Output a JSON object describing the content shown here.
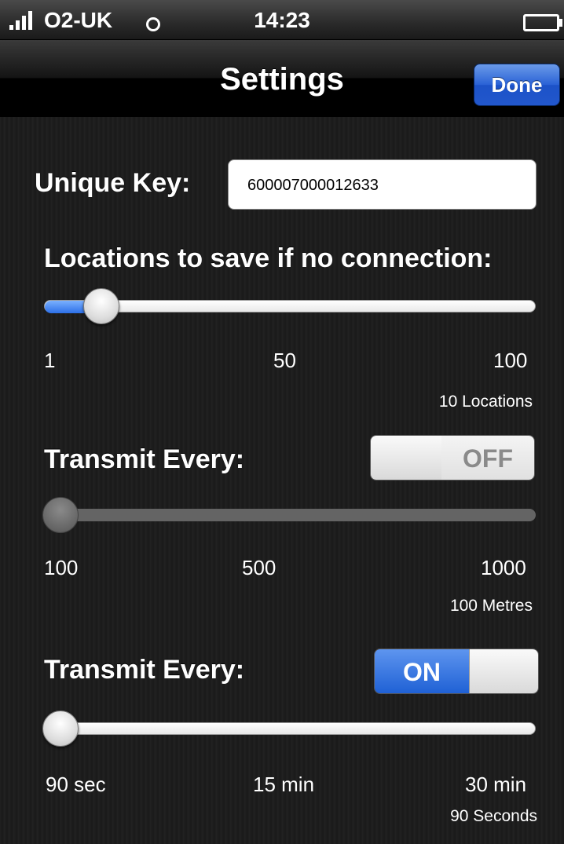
{
  "status_bar": {
    "carrier": "O2-UK",
    "time": "14:23"
  },
  "nav": {
    "title": "Settings",
    "done_label": "Done"
  },
  "unique_key": {
    "label": "Unique Key:",
    "value": "600007000012633"
  },
  "locations": {
    "label": "Locations to save if no connection:",
    "ticks": [
      "1",
      "50",
      "100"
    ],
    "value_text": "10 Locations",
    "slider_value": 10,
    "slider_min": 1,
    "slider_max": 100
  },
  "distance": {
    "label": "Transmit Every:",
    "switch_label": "OFF",
    "switch_on": false,
    "ticks": [
      "100",
      "500",
      "1000"
    ],
    "value_text": "100 Metres",
    "slider_value": 100,
    "slider_min": 100,
    "slider_max": 1000
  },
  "time_interval": {
    "label": "Transmit Every:",
    "switch_label": "ON",
    "switch_on": true,
    "ticks": [
      "90 sec",
      "15 min",
      "30 min"
    ],
    "value_text": "90 Seconds",
    "slider_value": 90,
    "slider_min": 90,
    "slider_max": 1800
  },
  "colors": {
    "accent_blue": "#2d70e8",
    "background": "#1d1d1d"
  },
  "icons": [
    "signal-bars-icon",
    "wifi-icon",
    "battery-charging-icon"
  ]
}
